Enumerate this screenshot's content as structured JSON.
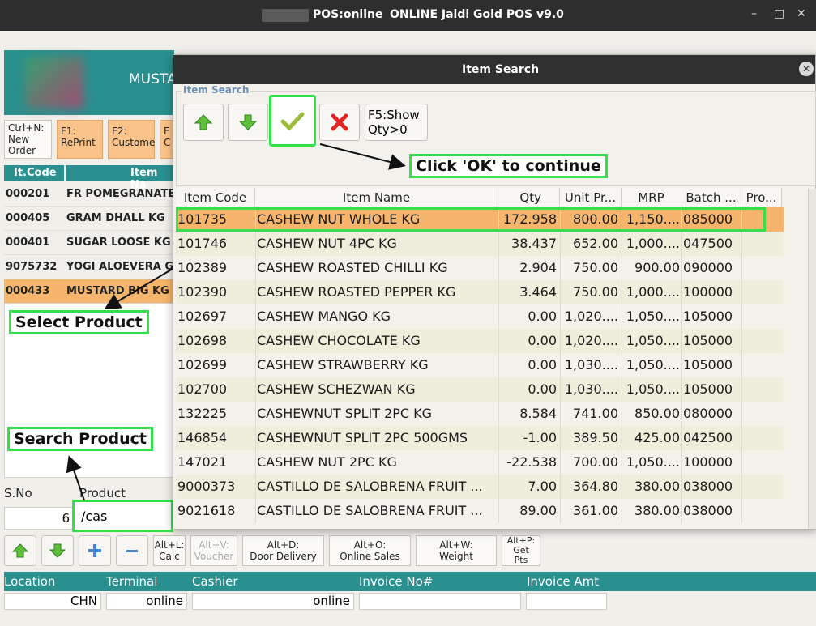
{
  "window": {
    "app_title": "POS:online",
    "product_title": "ONLINE Jaldi Gold POS v9.0",
    "minimize": "–",
    "maximize": "□",
    "close": "✕"
  },
  "banner": {
    "store_name": "MUSTA"
  },
  "function_buttons": [
    {
      "label": "Ctrl+N:\nNew\nOrder"
    },
    {
      "label": "F1:\nRePrint"
    },
    {
      "label": "F2:\nCustome"
    },
    {
      "label": "F\nC"
    }
  ],
  "order_table": {
    "headers": [
      "It.Code",
      "Item Na"
    ],
    "rows": [
      {
        "code": "000201",
        "name": "FR POMEGRANATE"
      },
      {
        "code": "000405",
        "name": "GRAM DHALL  KG"
      },
      {
        "code": "000401",
        "name": "SUGAR LOOSE KG"
      },
      {
        "code": "9075732",
        "name": "YOGI ALOEVERA G"
      },
      {
        "code": "000433",
        "name": "MUSTARD BIG KG"
      }
    ]
  },
  "entry": {
    "sno_label": "S.No",
    "product_label": "Product",
    "sno_value": "6",
    "product_value": "/cas"
  },
  "bottom_buttons": [
    {
      "label": "Alt+L:\nCalc"
    },
    {
      "label": "Alt+V:\nVoucher"
    },
    {
      "label": "Alt+D:\nDoor Delivery"
    },
    {
      "label": "Alt+O:\nOnline Sales"
    },
    {
      "label": "Alt+W:\nWeight"
    },
    {
      "label": "Alt+P:\nGet\nPts"
    }
  ],
  "footer": {
    "location_label": "Location",
    "terminal_label": "Terminal",
    "cashier_label": "Cashier",
    "invoice_no_label": "Invoice No#",
    "invoice_amt_label": "Invoice Amt",
    "location_value": "CHN",
    "terminal_value": "online",
    "cashier_value": "online",
    "invoice_no_value": "",
    "invoice_amt_value": ""
  },
  "dialog": {
    "title": "Item Search",
    "close": "✕",
    "group_label": "Item Search",
    "show_qty_button": "F5:Show\nQty>0",
    "columns": [
      "Item Code",
      "Item Name",
      "Qty",
      "Unit Pr...",
      "MRP",
      "Batch ...",
      "Pro..."
    ],
    "rows": [
      {
        "code": "101735",
        "name": "CASHEW NUT WHOLE KG",
        "qty": "172.958",
        "unit": "800.00",
        "mrp": "1,150....",
        "batch": "085000"
      },
      {
        "code": "101746",
        "name": "CASHEW NUT 4PC KG",
        "qty": "38.437",
        "unit": "652.00",
        "mrp": "1,000....",
        "batch": "047500"
      },
      {
        "code": "102389",
        "name": "CASHEW ROASTED CHILLI KG",
        "qty": "2.904",
        "unit": "750.00",
        "mrp": "900.00",
        "batch": "090000"
      },
      {
        "code": "102390",
        "name": "CASHEW ROASTED PEPPER KG",
        "qty": "3.464",
        "unit": "750.00",
        "mrp": "1,000....",
        "batch": "100000"
      },
      {
        "code": "102697",
        "name": "CASHEW MANGO KG",
        "qty": "0.00",
        "unit": "1,020....",
        "mrp": "1,050....",
        "batch": "105000"
      },
      {
        "code": "102698",
        "name": "CASHEW CHOCOLATE KG",
        "qty": "0.00",
        "unit": "1,020....",
        "mrp": "1,050....",
        "batch": "105000"
      },
      {
        "code": "102699",
        "name": "CASHEW STRAWBERRY KG",
        "qty": "0.00",
        "unit": "1,030....",
        "mrp": "1,050....",
        "batch": "105000"
      },
      {
        "code": "102700",
        "name": "CASHEW SCHEZWAN KG",
        "qty": "0.00",
        "unit": "1,030....",
        "mrp": "1,050....",
        "batch": "105000"
      },
      {
        "code": "132225",
        "name": "CASHEWNUT SPLIT 2PC KG",
        "qty": "8.584",
        "unit": "741.00",
        "mrp": "850.00",
        "batch": "080000"
      },
      {
        "code": "146854",
        "name": "CASHEWNUT SPLIT 2PC 500GMS",
        "qty": "-1.00",
        "unit": "389.50",
        "mrp": "425.00",
        "batch": "042500"
      },
      {
        "code": "147021",
        "name": "CASHEW NUT 2PC KG",
        "qty": "-22.538",
        "unit": "700.00",
        "mrp": "1,050....",
        "batch": "100000"
      },
      {
        "code": "9000373",
        "name": "CASTILLO DE SALOBRENA FRUIT ...",
        "qty": "7.00",
        "unit": "364.80",
        "mrp": "380.00",
        "batch": "038000"
      },
      {
        "code": "9021618",
        "name": "CASTILLO DE SALOBRENA FRUIT ...",
        "qty": "89.00",
        "unit": "361.00",
        "mrp": "380.00",
        "batch": "038000"
      }
    ]
  },
  "annotations": {
    "click_ok": "Click 'OK' to continue",
    "select_product": "Select Product",
    "search_product": "Search Product"
  },
  "colors": {
    "teal": "#2a8f8f",
    "highlight_orange": "#f6b56d",
    "annotation_green": "#33e04a"
  },
  "icons": {
    "up": "up-arrow-icon",
    "down": "down-arrow-icon",
    "ok": "checkmark-icon",
    "cancel": "red-x-icon",
    "plus": "plus-icon",
    "minus": "minus-icon"
  }
}
